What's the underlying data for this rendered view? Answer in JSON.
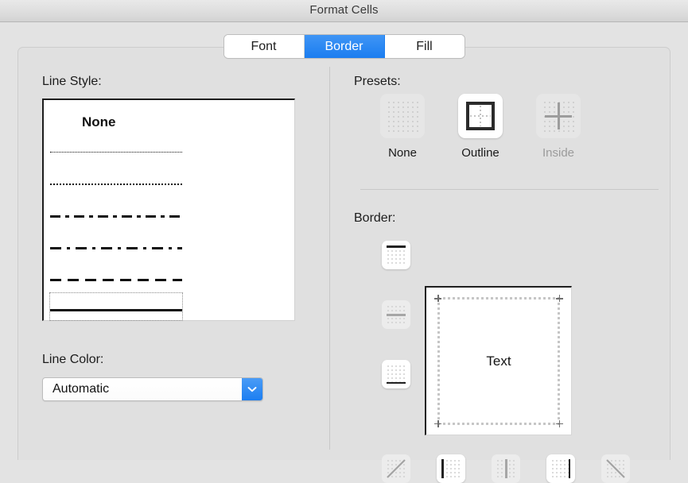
{
  "window": {
    "title": "Format Cells"
  },
  "tabs": [
    {
      "label": "Font",
      "active": false
    },
    {
      "label": "Border",
      "active": true
    },
    {
      "label": "Fill",
      "active": false
    }
  ],
  "left_pane": {
    "line_style_label": "Line Style:",
    "line_style_none_label": "None",
    "line_styles": [
      {
        "name": "none",
        "selected": false
      },
      {
        "name": "fine-dotted",
        "selected": false
      },
      {
        "name": "dotted",
        "selected": false
      },
      {
        "name": "dash-dot",
        "selected": false
      },
      {
        "name": "long-dash-dot",
        "selected": false
      },
      {
        "name": "dashed",
        "selected": false
      },
      {
        "name": "solid",
        "selected": true
      }
    ],
    "line_color_label": "Line Color:",
    "line_color_value": "Automatic",
    "line_color_options": [
      "Automatic"
    ]
  },
  "right_pane": {
    "presets_label": "Presets:",
    "presets": [
      {
        "label": "None",
        "icon": "preset-none-icon",
        "state": "normal"
      },
      {
        "label": "Outline",
        "icon": "preset-outline-icon",
        "state": "selected"
      },
      {
        "label": "Inside",
        "icon": "preset-inside-icon",
        "state": "disabled"
      }
    ],
    "border_label": "Border:",
    "side_buttons": [
      {
        "icon": "border-top-icon",
        "state": "normal"
      },
      {
        "icon": "border-middle-horizontal-icon",
        "state": "disabled"
      },
      {
        "icon": "border-bottom-icon",
        "state": "normal"
      }
    ],
    "bottom_buttons": [
      {
        "icon": "border-diagonal-up-icon",
        "state": "disabled"
      },
      {
        "icon": "border-left-icon",
        "state": "normal"
      },
      {
        "icon": "border-middle-vertical-icon",
        "state": "disabled"
      },
      {
        "icon": "border-right-icon",
        "state": "normal"
      },
      {
        "icon": "border-diagonal-down-icon",
        "state": "disabled"
      }
    ],
    "preview_text": "Text"
  },
  "colors": {
    "accent": "#1b7df0",
    "window_bg": "#e3e3e3",
    "panel_bg": "#e0e0e0",
    "line_dark": "#111111",
    "disabled_gray": "#9b9b9b"
  }
}
